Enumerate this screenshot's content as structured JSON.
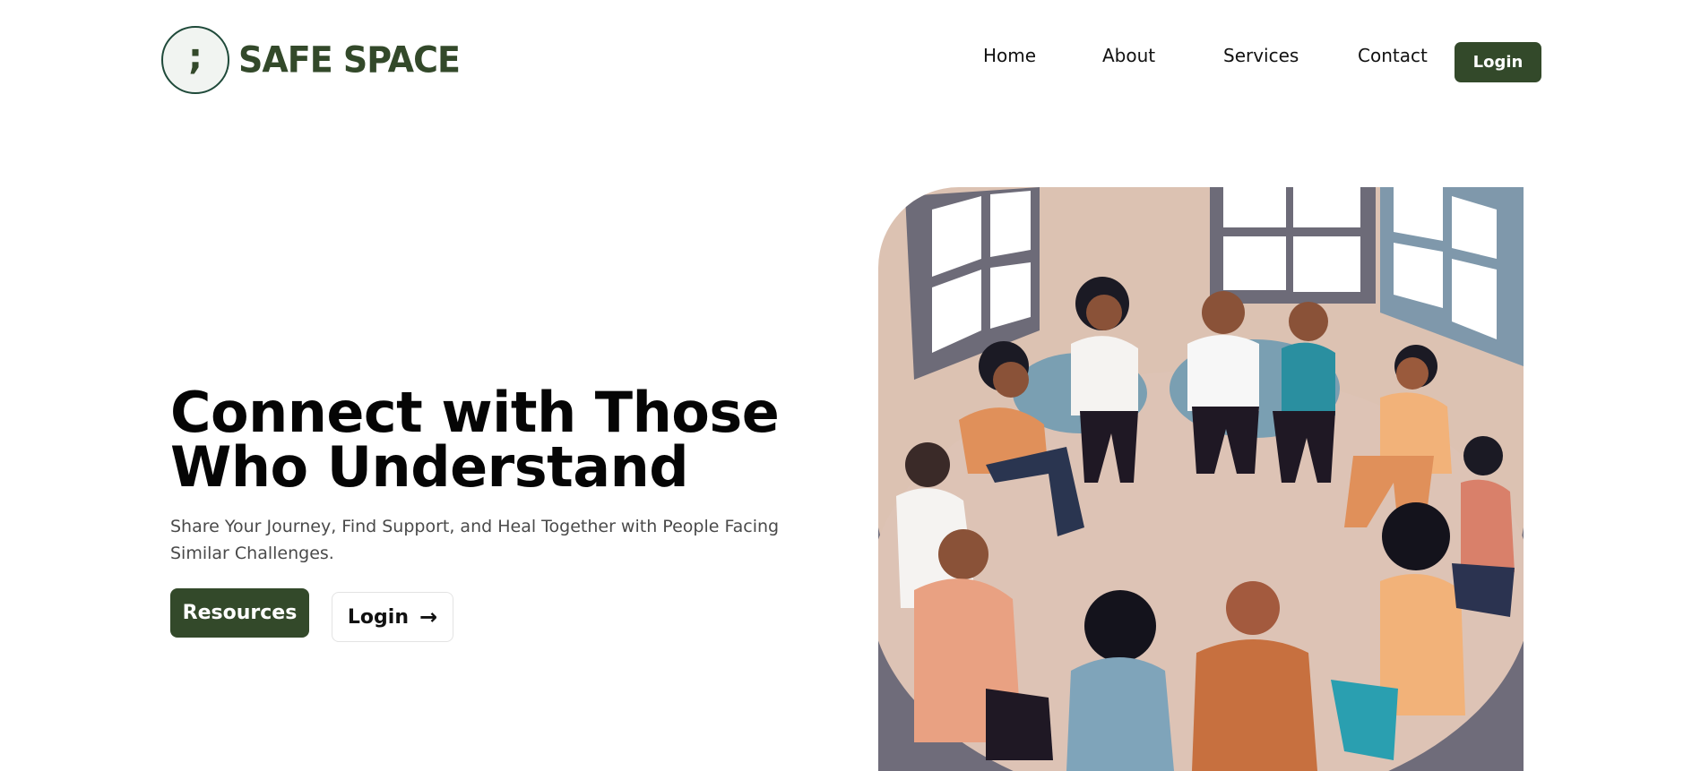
{
  "brand": {
    "logo_mark": ";",
    "name": "SAFE SPACE"
  },
  "nav": {
    "items": [
      "Home",
      "About",
      "Services",
      "Contact"
    ],
    "login_label": "Login"
  },
  "hero": {
    "title_line1": "Connect with Those",
    "title_line2": "Who Understand",
    "subtitle": "Share Your Journey, Find Support, and Heal Together with People Facing Similar Challenges.",
    "resources_label": "Resources",
    "login_label": "Login",
    "login_arrow": "→"
  },
  "colors": {
    "brand_green": "#33492a",
    "logo_ring": "#1f4a3a",
    "text_dark": "#050505",
    "text_muted": "#4a4a4a"
  },
  "icons": {
    "logo": "semicolon-icon",
    "login_arrow": "arrow-right-icon",
    "illustration": "support-group-circle-illustration"
  }
}
